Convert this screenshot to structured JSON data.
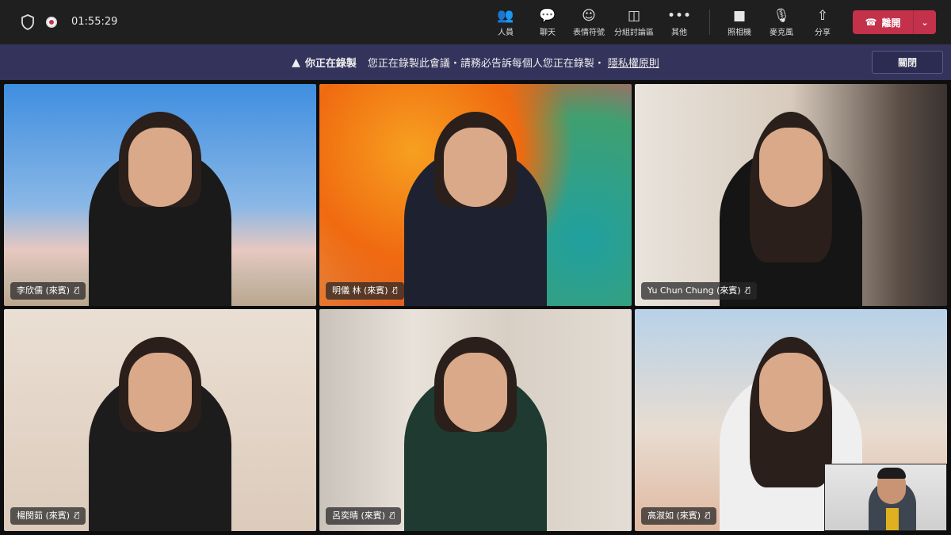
{
  "topbar": {
    "timer": "01:55:29",
    "buttons": [
      {
        "label": "人員",
        "icon": "people-icon",
        "glyph": "👥"
      },
      {
        "label": "聊天",
        "icon": "chat-icon",
        "glyph": "💬"
      },
      {
        "label": "表情符號",
        "icon": "reaction-icon",
        "glyph": "☺"
      },
      {
        "label": "分組討論區",
        "icon": "breakout-rooms-icon",
        "glyph": "◫"
      },
      {
        "label": "其他",
        "icon": "more-icon",
        "glyph": "•••"
      },
      {
        "label": "照相機",
        "icon": "camera-icon",
        "glyph": "■"
      },
      {
        "label": "麥克風",
        "icon": "microphone-icon",
        "glyph": "🎙"
      },
      {
        "label": "分享",
        "icon": "share-icon",
        "glyph": "⇧"
      }
    ],
    "leave_label": "離開"
  },
  "banner": {
    "title": "你正在錄製",
    "message": "您正在錄製此會議・請務必告訴每個人您正在錄製・",
    "link": "隱私權原則",
    "close_label": "關閉"
  },
  "participants": [
    {
      "name": "李欣儒 (來賓)"
    },
    {
      "name": "明儀 林 (來賓)"
    },
    {
      "name": "Yu Chun Chung (來賓)"
    },
    {
      "name": "楊閔茹 (來賓)"
    },
    {
      "name": "呂奕晴 (來賓)"
    },
    {
      "name": "高淑如 (來賓)"
    }
  ],
  "colors": {
    "leave": "#c4314b",
    "banner": "#33335c",
    "topbar": "#201f1f"
  }
}
